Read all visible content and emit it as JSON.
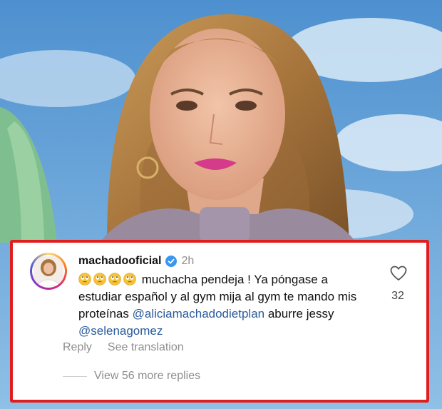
{
  "comment": {
    "username": "machadooficial",
    "time": "2h",
    "emojis": [
      "face-with-rolling-eyes",
      "face-with-rolling-eyes",
      "face-with-rolling-eyes",
      "face-with-rolling-eyes"
    ],
    "text_part1": "muchacha pendeja ! Ya póngase a estudiar español y al gym mija al gym te mando mis proteínas",
    "mention1": "@aliciamachadodietplan",
    "text_part2": "aburre jessy",
    "mention2": "@selenagomez",
    "like_count": "32",
    "reply_label": "Reply",
    "translate_label": "See translation",
    "view_replies_label": "View 56 more replies"
  },
  "colors": {
    "highlight_border": "#e01e1e",
    "mention": "#2a5b9c",
    "verified": "#3897f0",
    "secondary_text": "#8e8e8e"
  }
}
